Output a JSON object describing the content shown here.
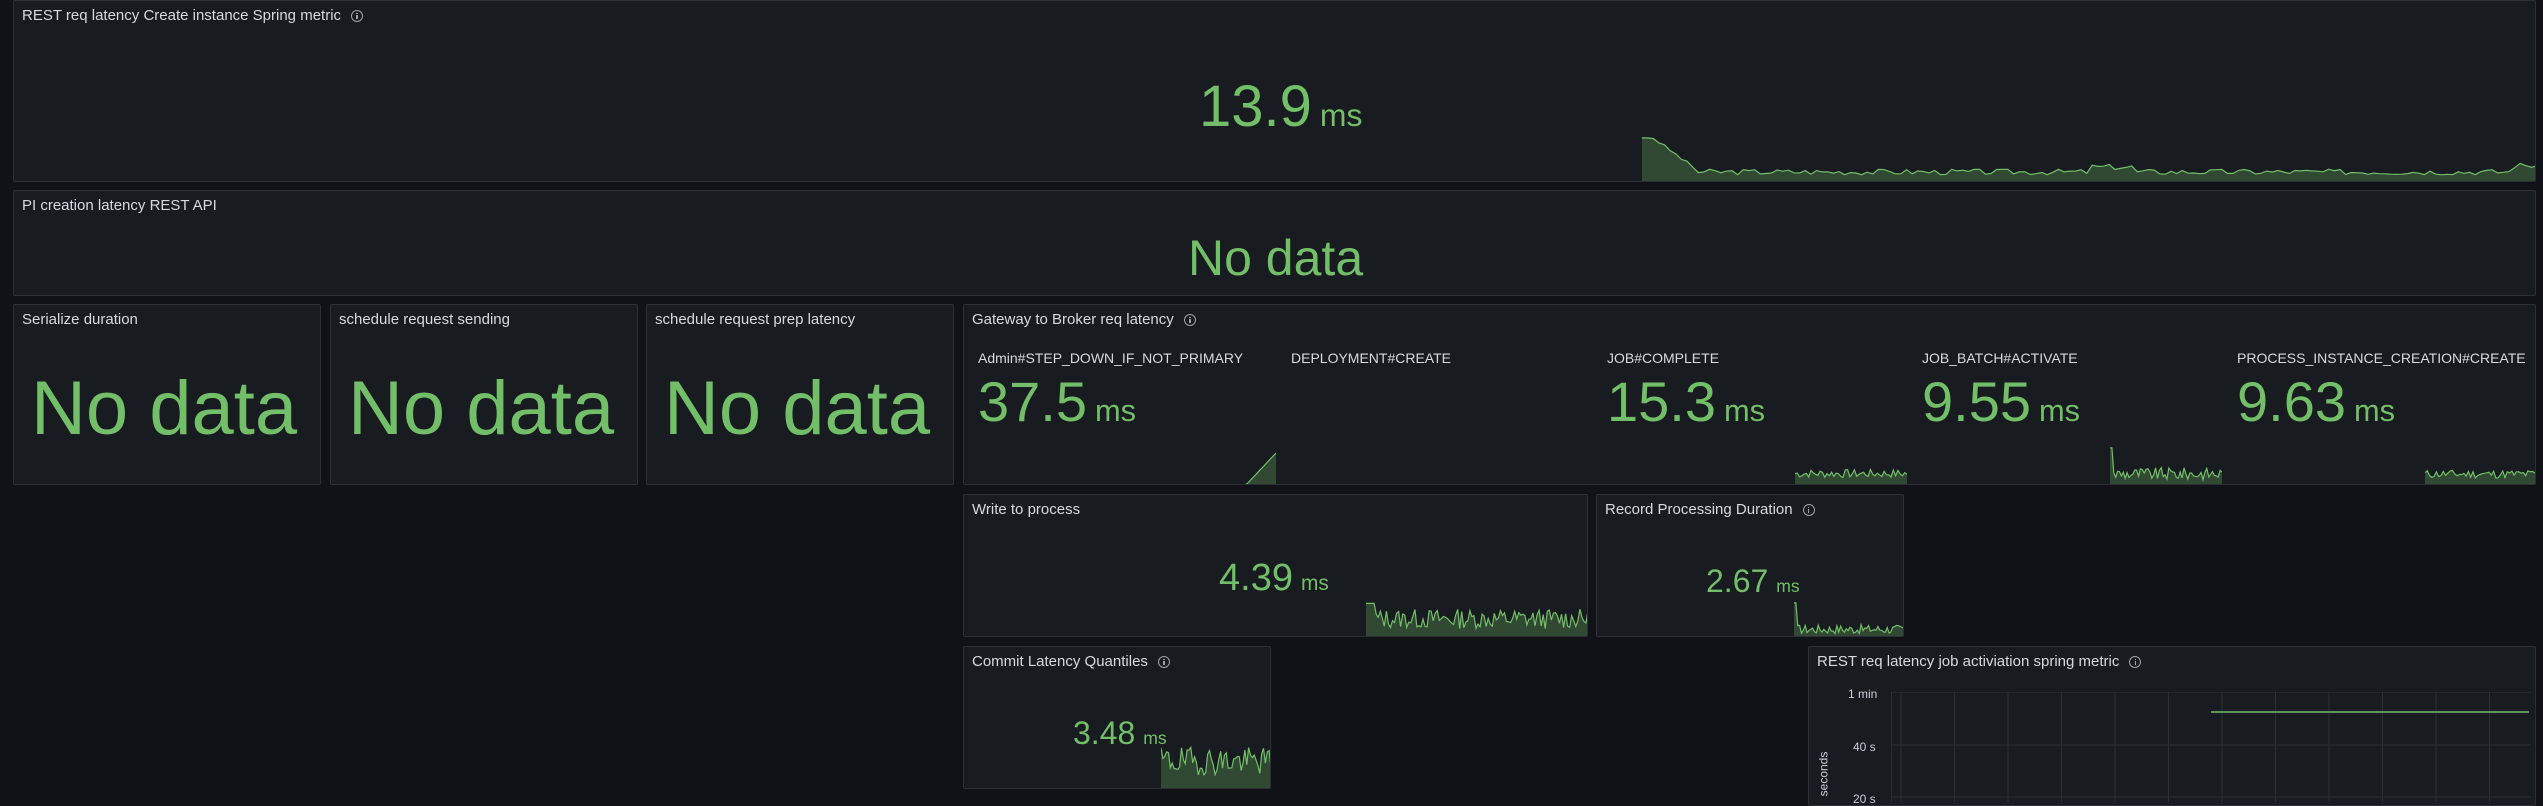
{
  "panels": {
    "rest_create": {
      "title": "REST req latency Create instance Spring metric",
      "value": "13.9",
      "unit": "ms"
    },
    "pi_creation": {
      "title": "PI creation latency REST API",
      "value": "No data"
    },
    "serialize": {
      "title": "Serialize duration",
      "value": "No data"
    },
    "schedule_sending": {
      "title": "schedule request sending",
      "value": "No data"
    },
    "schedule_prep": {
      "title": "schedule request prep latency",
      "value": "No data"
    },
    "gateway": {
      "title": "Gateway to Broker req latency",
      "items": [
        {
          "label": "Admin#STEP_DOWN_IF_NOT_PRIMARY",
          "value": "37.5",
          "unit": "ms"
        },
        {
          "label": "DEPLOYMENT#CREATE",
          "value": "",
          "unit": ""
        },
        {
          "label": "JOB#COMPLETE",
          "value": "15.3",
          "unit": "ms"
        },
        {
          "label": "JOB_BATCH#ACTIVATE",
          "value": "9.55",
          "unit": "ms"
        },
        {
          "label": "PROCESS_INSTANCE_CREATION#CREATE",
          "value": "9.63",
          "unit": "ms"
        }
      ]
    },
    "write_process": {
      "title": "Write to process",
      "value": "4.39",
      "unit": "ms"
    },
    "record_processing": {
      "title": "Record Processing Duration",
      "value": "2.67",
      "unit": "ms"
    },
    "commit_latency": {
      "title": "Commit Latency Quantiles",
      "value": "3.48",
      "unit": "ms"
    },
    "rest_job": {
      "title": "REST req latency job activiation spring metric",
      "y_ticks": [
        "1 min",
        "40 s",
        "20 s"
      ],
      "y_axis_label": "seconds"
    }
  },
  "colors": {
    "accent": "#73bf69",
    "background": "#111217",
    "panel": "#181b1f",
    "border": "#2c2f36"
  },
  "icons": [
    "info-icon"
  ]
}
